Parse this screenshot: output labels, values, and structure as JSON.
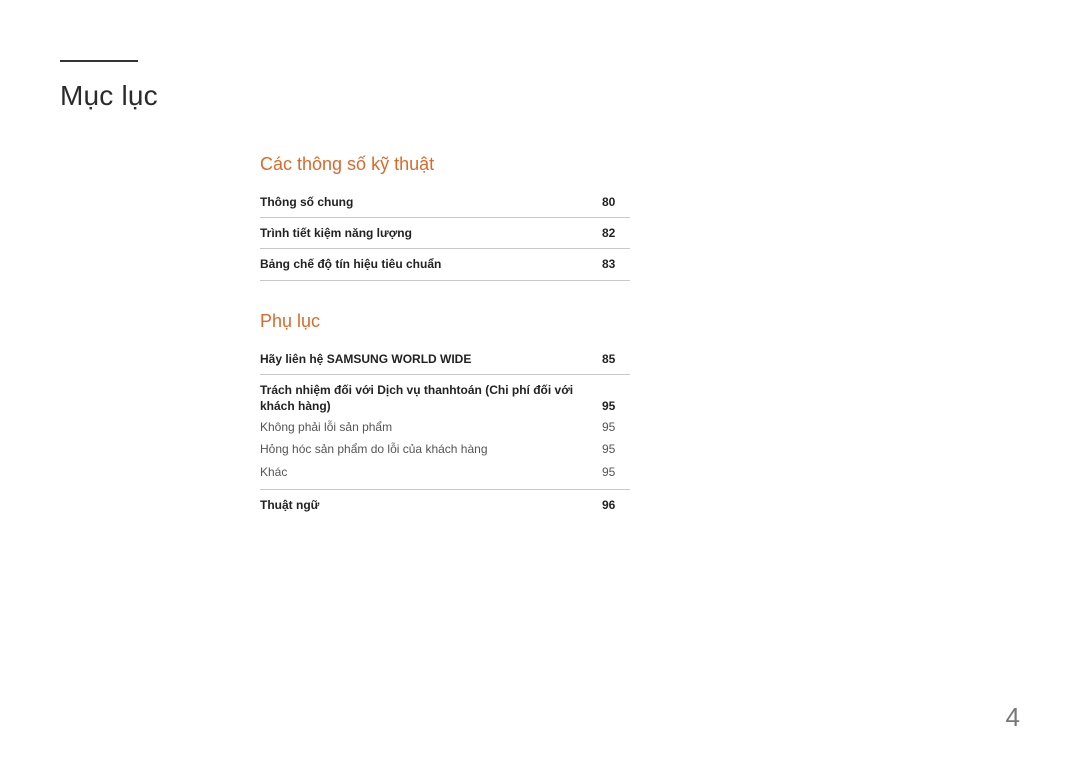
{
  "page_title": "Mục lục",
  "page_number": "4",
  "sections": [
    {
      "heading": "Các thông số kỹ thuật",
      "entries": [
        {
          "label": "Thông số chung",
          "page": "80",
          "bold": true
        },
        {
          "label": "Trình tiết kiệm năng lượng",
          "page": "82",
          "bold": true
        },
        {
          "label": "Bảng chế độ tín hiệu tiêu chuẩn",
          "page": "83",
          "bold": true
        }
      ]
    },
    {
      "heading": "Phụ lục",
      "entries_grouped": [
        {
          "group": [
            {
              "label": "Hãy liên hệ SAMSUNG WORLD WIDE",
              "page": "85",
              "bold": true
            }
          ]
        },
        {
          "group": [
            {
              "label": "Trách nhiệm đối với Dịch vụ thanhtoán (Chi phí đối với khách hàng)",
              "page": "95",
              "bold": true
            },
            {
              "label": "Không phải lỗi sản phẩm",
              "page": "95",
              "bold": false
            },
            {
              "label": "Hỏng hóc sản phẩm do lỗi của khách hàng",
              "page": "95",
              "bold": false
            },
            {
              "label": "Khác",
              "page": "95",
              "bold": false
            }
          ]
        },
        {
          "group": [
            {
              "label": "Thuật ngữ",
              "page": "96",
              "bold": true
            }
          ]
        }
      ]
    }
  ]
}
